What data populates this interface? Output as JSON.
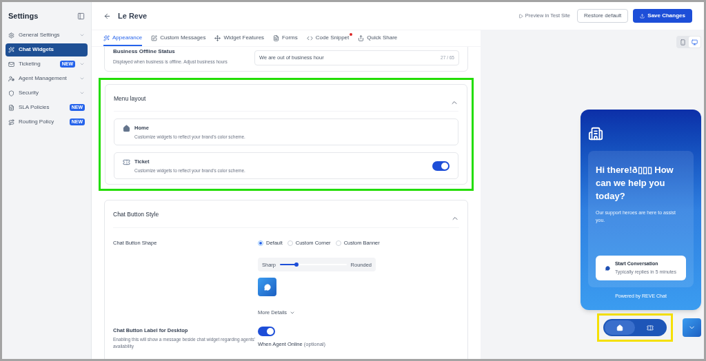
{
  "sidebar": {
    "title": "Settings",
    "items": [
      {
        "kind": "gear",
        "label": "General Settings",
        "selected": false,
        "expandable": true
      },
      {
        "kind": "wand",
        "label": "Chat Widgets",
        "selected": true,
        "expandable": false
      },
      {
        "kind": "mail",
        "label": "Ticketing",
        "selected": false,
        "expandable": true,
        "badge": "NEW"
      },
      {
        "kind": "agent",
        "label": "Agent Management",
        "selected": false,
        "expandable": true
      },
      {
        "kind": "shield",
        "label": "Security",
        "selected": false,
        "expandable": true
      },
      {
        "kind": "file",
        "label": "SLA Policies",
        "selected": false,
        "expandable": false,
        "badge": "NEW"
      },
      {
        "kind": "route",
        "label": "Routing Policy",
        "selected": false,
        "expandable": false,
        "badge": "NEW"
      }
    ]
  },
  "header": {
    "title": "Le Reve",
    "preview": "Preview in Test Site",
    "restore": "Restore default",
    "save": "Save Changes"
  },
  "tabs": [
    {
      "kind": "wand",
      "label": "Appearance",
      "selected": true,
      "notification": false
    },
    {
      "kind": "edit",
      "label": "Custom Messages",
      "selected": false,
      "notification": false
    },
    {
      "kind": "move",
      "label": "Widget Features",
      "selected": false,
      "notification": false
    },
    {
      "kind": "form",
      "label": "Forms",
      "selected": false,
      "notification": false
    },
    {
      "kind": "code",
      "label": "Code Snippet",
      "selected": false,
      "notification": true
    },
    {
      "kind": "share",
      "label": "Quick Share",
      "selected": false,
      "notification": false
    }
  ],
  "offline_status": {
    "label": "Business Offline Status",
    "description": "Displayed when business is offline. Adjust business hours",
    "value": "We are out of business hour",
    "counter": "27 / 65"
  },
  "menu_layout": {
    "title": "Menu layout",
    "expanded": true,
    "items": [
      {
        "kind": "home",
        "title": "Home",
        "description": "Customize widgets to reflect your brand's color scheme."
      },
      {
        "kind": "ticket",
        "title": "Ticket",
        "description": "Customize widgets to reflect your brand's color scheme.",
        "on": true
      }
    ]
  },
  "chat_button_style": {
    "title": "Chat Button Style",
    "expanded": true,
    "shape_label": "Chat Button Shape",
    "shapes": [
      {
        "label": "Default",
        "selected": true
      },
      {
        "label": "Custom Corner",
        "selected": false
      },
      {
        "label": "Custom Banner",
        "selected": false
      }
    ],
    "slider": {
      "min_label": "Sharp",
      "max_label": "Rounded",
      "level": 0.25
    },
    "more_details": "More Details",
    "label_setting": {
      "title": "Chat Button Label for Desktop",
      "description": "Enabling this will show a message beside chat widget regarding agents' availability",
      "on": true,
      "online_label": "When Agent Online",
      "optional": "(optional)"
    }
  },
  "device_toggle": [
    {
      "kind": "mobile",
      "selected": false
    },
    {
      "kind": "desktop",
      "selected": true
    }
  ],
  "widget": {
    "greeting": "Hi there!ð▯▯▯ How can we help you today?",
    "subtitle": "Our support heroes are here to assist you.",
    "cta_title": "Start Conversation",
    "cta_subtitle": "Typically replies in 5 minutes",
    "powered_by": "Powered by REVE Chat"
  },
  "bottom_nav": [
    {
      "kind": "home",
      "selected": true
    },
    {
      "kind": "ticket",
      "selected": false
    }
  ]
}
